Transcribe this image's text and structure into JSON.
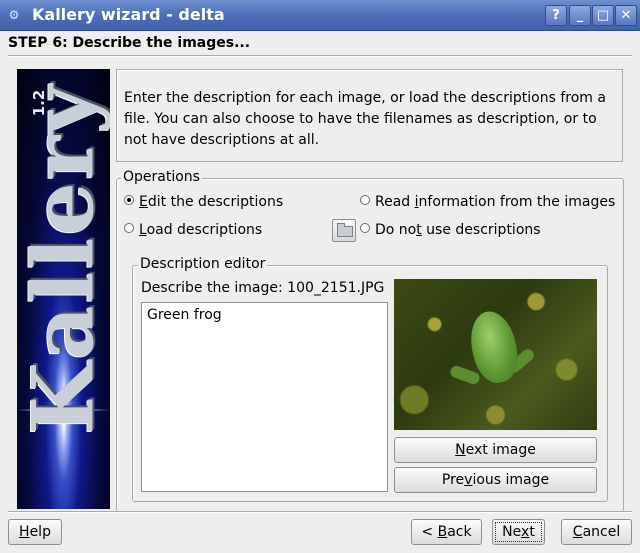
{
  "window": {
    "title": "Kallery wizard - delta",
    "buttons": {
      "help": "?",
      "minimize": "_",
      "maximize": "□",
      "close": "✕"
    }
  },
  "step_title": "STEP 6: Describe the images...",
  "banner": {
    "word": "Kallery",
    "version": "1.2"
  },
  "intro_text": "Enter the description for each image, or load the descriptions from a file. You can also choose to have the filenames as description, or to not have descriptions at all.",
  "operations": {
    "title": "Operations",
    "edit": {
      "pre": "",
      "key": "E",
      "post": "dit the descriptions",
      "selected": true
    },
    "read": {
      "pre": "Read ",
      "key": "i",
      "post": "nformation from the images",
      "selected": false
    },
    "load": {
      "pre": "",
      "key": "L",
      "post": "oad descriptions",
      "selected": false
    },
    "none": {
      "pre": "Do no",
      "key": "t",
      "post": " use descriptions",
      "selected": false
    }
  },
  "editor": {
    "title": "Description editor",
    "describe_label": "Describe the image: 100_2151.JPG",
    "description_value": "Green frog",
    "next": {
      "pre": "",
      "key": "N",
      "post": "ext image"
    },
    "prev": {
      "pre": "Pre",
      "key": "v",
      "post": "ious image"
    }
  },
  "footer": {
    "help": {
      "pre": "",
      "key": "H",
      "post": "elp"
    },
    "back": {
      "pre": "< ",
      "key": "B",
      "post": "ack"
    },
    "next": {
      "pre": "Ne",
      "key": "x",
      "post": "t"
    },
    "cancel": {
      "pre": "",
      "key": "C",
      "post": "ancel"
    }
  }
}
